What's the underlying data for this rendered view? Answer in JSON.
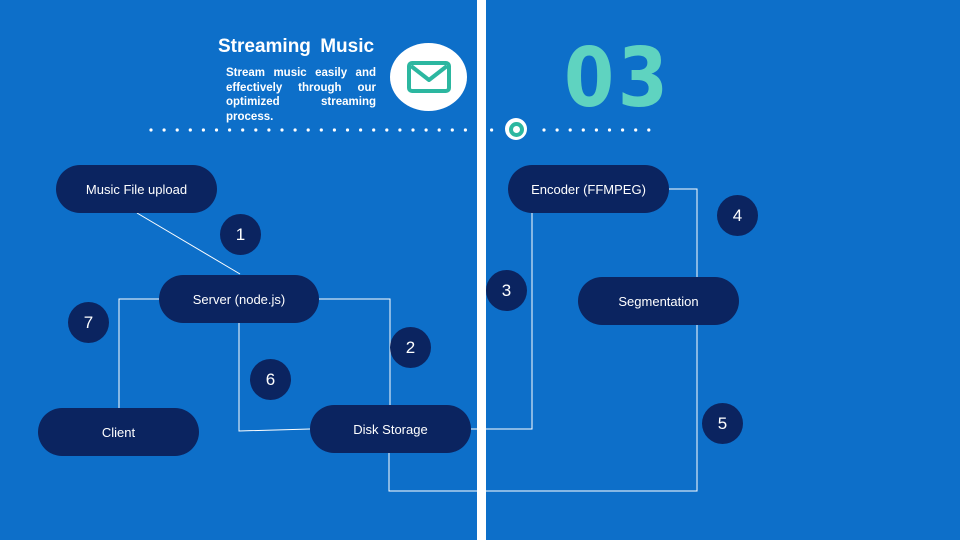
{
  "header": {
    "title": "Streaming  Music",
    "subtitle": "Stream music easily and effectively through our optimized streaming process.",
    "section_number": "03",
    "icon": "mail-icon"
  },
  "colors": {
    "background": "#0d6fc9",
    "node": "#0b2460",
    "accent": "#5fd3c0",
    "line": "#ffffff"
  },
  "nodes": {
    "upload": "Music File upload",
    "server": "Server (node.js)",
    "client": "Client",
    "disk": "Disk Storage",
    "encoder": "Encoder (FFMPEG)",
    "segmentation": "Segmentation"
  },
  "steps": {
    "s1": "1",
    "s2": "2",
    "s3": "3",
    "s4": "4",
    "s5": "5",
    "s6": "6",
    "s7": "7"
  }
}
